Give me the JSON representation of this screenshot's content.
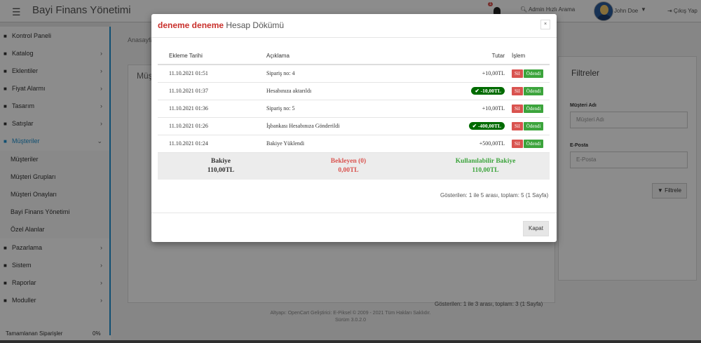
{
  "header": {
    "brand": "Bayi Finans Yönetimi",
    "notification_count": "1",
    "search_label": "Admin Hızlı Arama",
    "user_name": "John Doe",
    "logout_label": "Çıkış Yap"
  },
  "sidebar": {
    "items": [
      {
        "label": "Kontrol Paneli",
        "icon": "dashboard-icon",
        "chevron": ""
      },
      {
        "label": "Katalog",
        "icon": "tag-icon",
        "chevron": "›"
      },
      {
        "label": "Eklentiler",
        "icon": "puzzle-icon",
        "chevron": "›"
      },
      {
        "label": "Fiyat Alarmı",
        "icon": "bell-icon",
        "chevron": "›"
      },
      {
        "label": "Tasarım",
        "icon": "monitor-icon",
        "chevron": "›"
      },
      {
        "label": "Satışlar",
        "icon": "cart-icon",
        "chevron": "›"
      },
      {
        "label": "Müşteriler",
        "icon": "user-icon",
        "chevron": "⌄"
      }
    ],
    "subitems": [
      {
        "label": "Müşteriler"
      },
      {
        "label": "Müşteri Grupları"
      },
      {
        "label": "Müşteri Onayları"
      },
      {
        "label": "Bayi Finans Yönetimi"
      },
      {
        "label": "Özel Alanlar"
      }
    ],
    "items2": [
      {
        "label": "Pazarlama",
        "icon": "share-icon",
        "chevron": "›"
      },
      {
        "label": "Sistem",
        "icon": "cog-icon",
        "chevron": "›"
      },
      {
        "label": "Raporlar",
        "icon": "chart-icon",
        "chevron": "›"
      },
      {
        "label": "Moduller",
        "icon": "plug-icon",
        "chevron": "›"
      }
    ],
    "progress_label": "Tamamlanan Siparişler",
    "progress_value": "0%"
  },
  "content": {
    "breadcrumb": "Anasayfa",
    "list_heading": "Müşteriler",
    "list_footer": "Gösterilen: 1 ile 3 arası, toplam: 3 (1 Sayfa)"
  },
  "filters": {
    "heading": "Filtreler",
    "name_label": "Müşteri Adı",
    "name_placeholder": "Müşteri Adı",
    "email_label": "E-Posta",
    "email_placeholder": "E-Posta",
    "button_label": "Filtrele"
  },
  "footer": {
    "line1": "Altyapı: OpenCart Geliştirici: E-Piksel © 2009 - 2021 Tüm Hakları Saklıdır.",
    "line2": "Sürüm 3.0.2.0"
  },
  "modal": {
    "customer_name": "deneme deneme",
    "title_suffix": "Hesap Dökümü",
    "close_x": "×",
    "columns": {
      "date": "Ekleme Tarihi",
      "desc": "Açıklama",
      "amount": "Tutar",
      "action": "İşlem"
    },
    "rows": [
      {
        "date": "11.10.2021 01:51",
        "desc": "Sipariş no: 4",
        "amount": "+10,00TL",
        "negative": false
      },
      {
        "date": "11.10.2021 01:37",
        "desc": "Hesabınıza aktarıldı",
        "amount": "-10,00TL",
        "negative": true
      },
      {
        "date": "11.10.2021 01:36",
        "desc": "Sipariş no: 5",
        "amount": "+10,00TL",
        "negative": false
      },
      {
        "date": "11.10.2021 01:26",
        "desc": "İşbankası Hesabınıza Gönderildi",
        "amount": "-400,00TL",
        "negative": true
      },
      {
        "date": "11.10.2021 01:24",
        "desc": "Bakiye Yüklendi",
        "amount": "+500,00TL",
        "negative": false
      }
    ],
    "delete_label": "Sil",
    "paid_label": "Ödendi",
    "summary": {
      "balance_label": "Bakiye",
      "balance_value": "110,00TL",
      "pending_label": "Bekleyen (0)",
      "pending_value": "0,00TL",
      "available_label": "Kullanılabilir Bakiye",
      "available_value": "110,00TL"
    },
    "pager": "Gösterilen: 1 ile 5 arası, toplam: 5 (1 Sayfa)",
    "close_button": "Kapat"
  },
  "colors": {
    "accent": "#1e91cf",
    "danger": "#d9534f",
    "success": "#3ca43c",
    "negative_badge": "#006b00",
    "pending_text": "#d9534f",
    "available_text": "#3ca43c"
  }
}
